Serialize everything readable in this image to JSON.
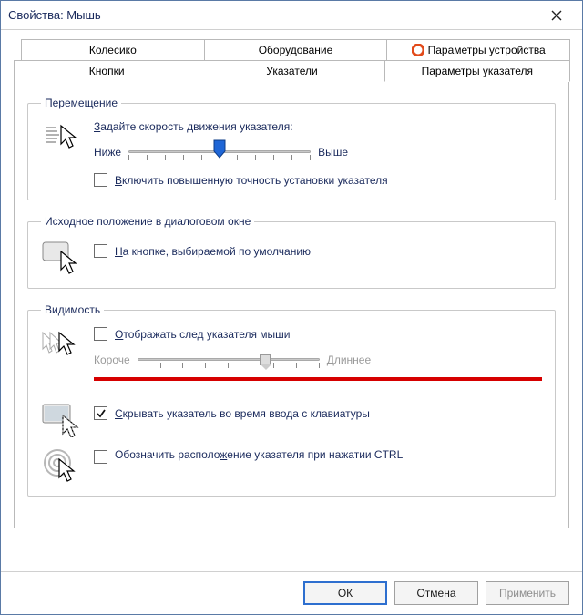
{
  "window": {
    "title": "Свойства: Мышь"
  },
  "tabs": {
    "top": [
      {
        "label": "Колесико"
      },
      {
        "label": "Оборудование"
      },
      {
        "label": "Параметры устройства",
        "decorated": true
      }
    ],
    "bottom": [
      {
        "label": "Кнопки"
      },
      {
        "label": "Указатели"
      },
      {
        "label": "Параметры указателя",
        "active": true
      }
    ]
  },
  "groups": {
    "motion": {
      "legend": "Перемещение",
      "speed_caption": "Задайте скорость движения указателя:",
      "slower": "Ниже",
      "faster": "Выше",
      "enhance": "Включить повышенную точность установки указателя",
      "slider_value": 5,
      "slider_ticks": 11
    },
    "snap": {
      "legend": "Исходное положение в диалоговом окне",
      "text": "На кнопке, выбираемой по умолчанию"
    },
    "visibility": {
      "legend": "Видимость",
      "trail": "Отображать след указателя мыши",
      "shorter": "Короче",
      "longer": "Длиннее",
      "trail_value": 6,
      "trail_ticks": 9,
      "hide_typing": "Скрывать указатель во время ввода с клавиатуры",
      "show_ctrl": "Обозначить расположение указателя при нажатии CTRL"
    }
  },
  "buttons": {
    "ok": "ОК",
    "cancel": "Отмена",
    "apply": "Применить"
  }
}
